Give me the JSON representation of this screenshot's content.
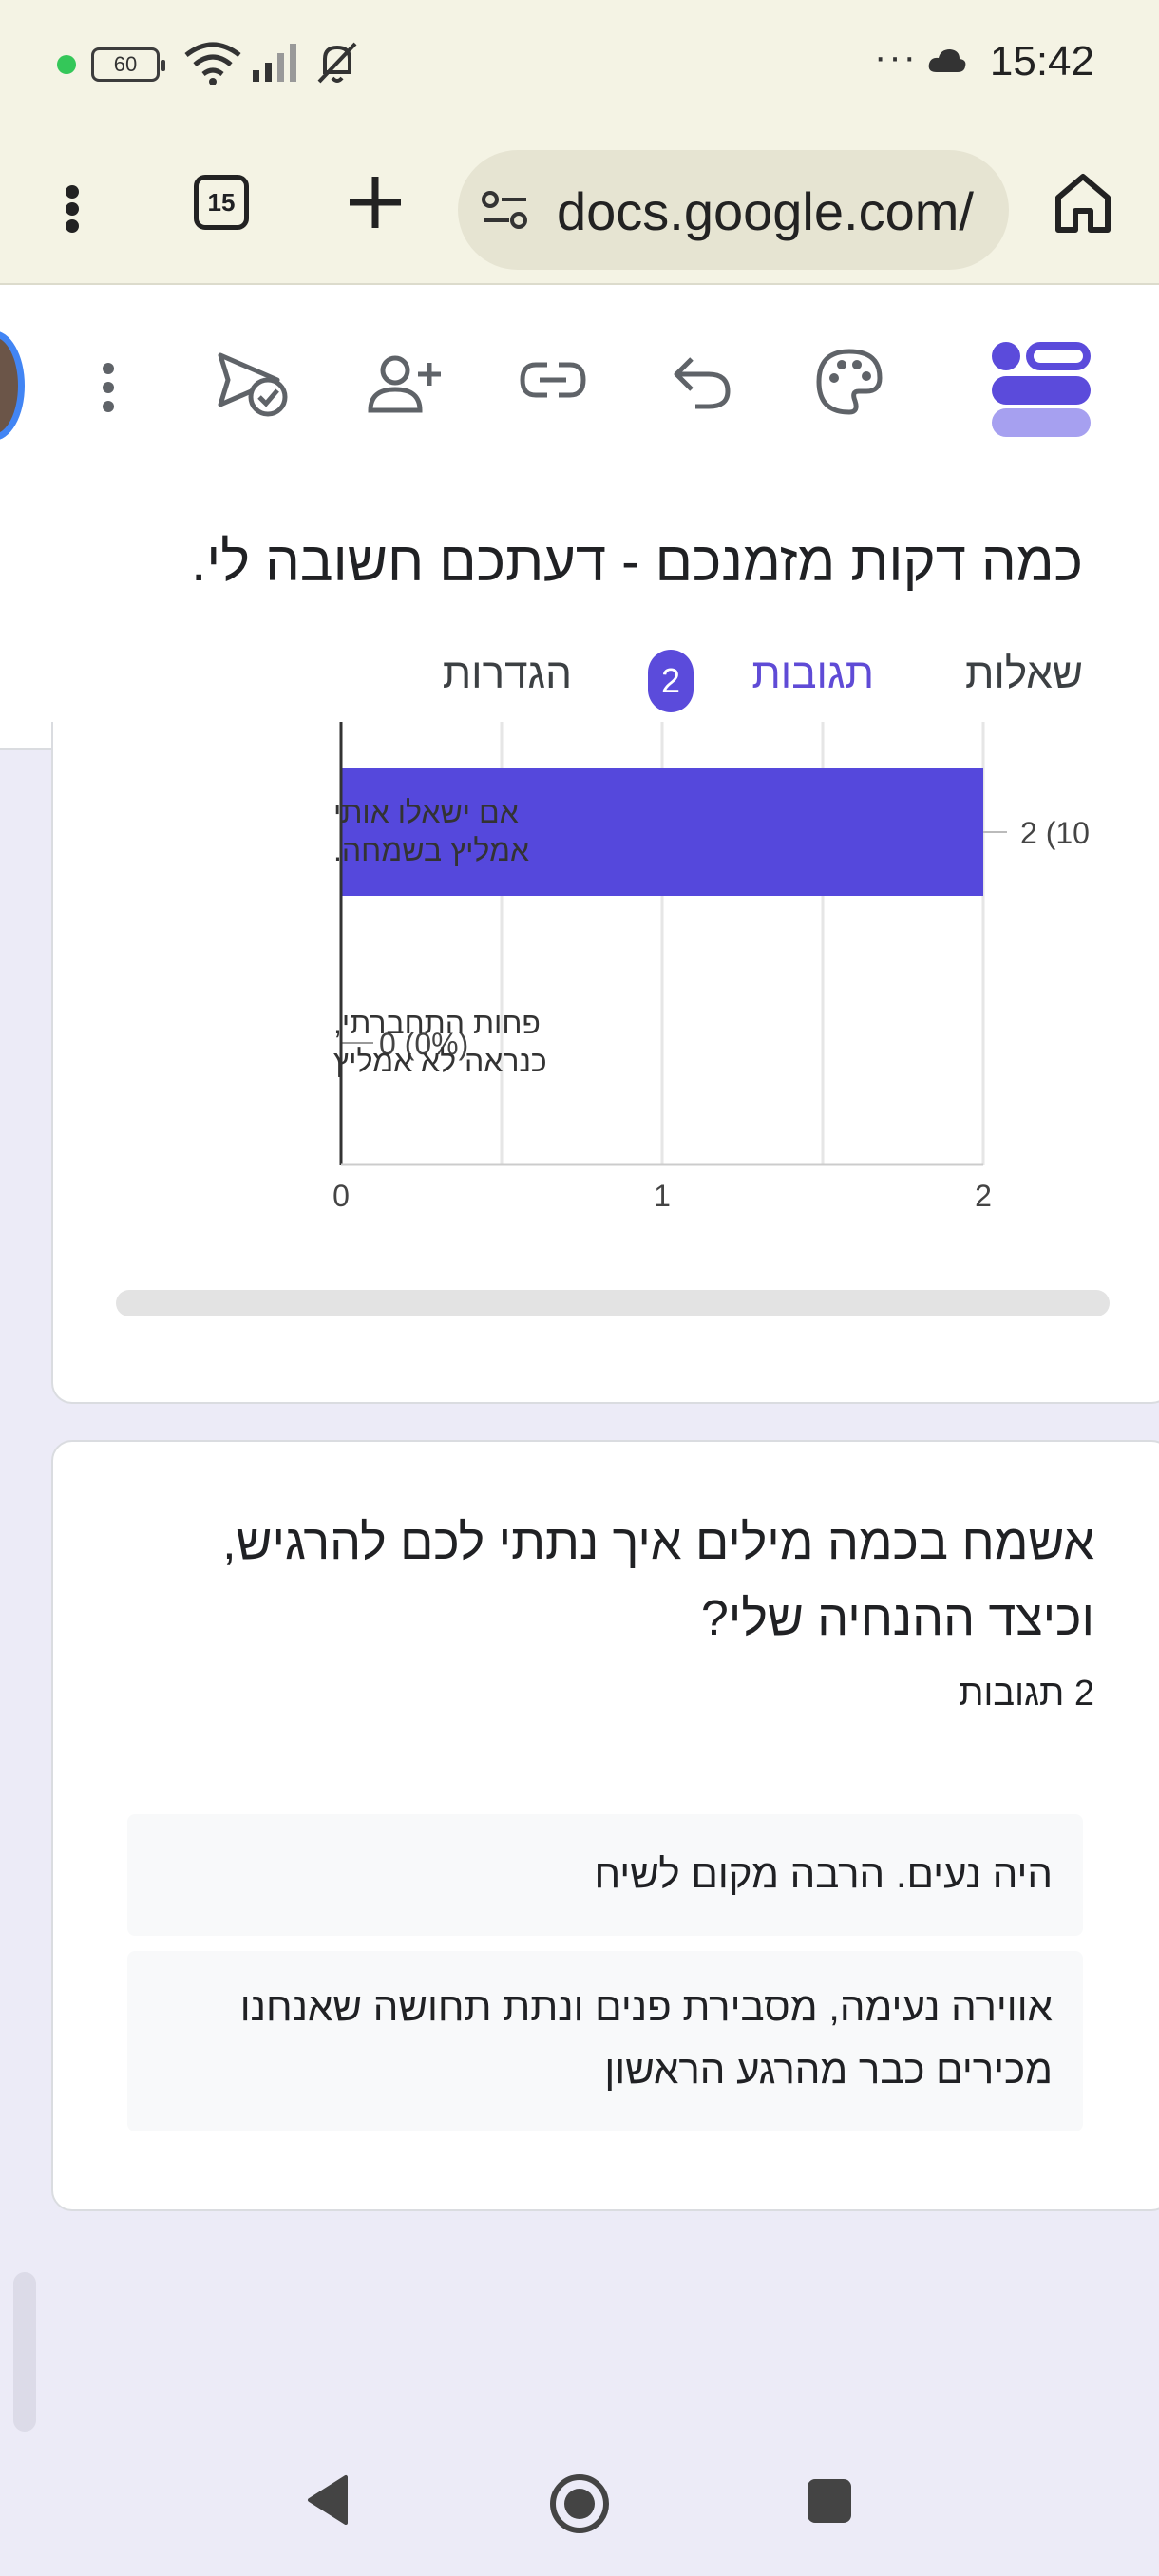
{
  "status_bar": {
    "time": "15:42",
    "battery": "60",
    "more": "···"
  },
  "browser": {
    "tab_count": "15",
    "url": "docs.google.com/"
  },
  "form": {
    "title": "כמה דקות מזמנכם - דעתכם חשובה לי.",
    "tabs": {
      "questions": "שאלות",
      "responses": "תגובות",
      "responses_count": "2",
      "settings": "הגדרות"
    }
  },
  "chart_data": {
    "type": "bar",
    "orientation": "horizontal",
    "categories": [
      "אם ישאלו אותי אמליץ בשמחה.",
      "פחות התחברתי, כנראה לא אמליץ"
    ],
    "category_lines": [
      [
        "אם ישאלו אותי",
        "אמליץ בשמחה."
      ],
      [
        "פחות התחברתי,",
        "כנראה לא אמליץ"
      ]
    ],
    "values": [
      2,
      0
    ],
    "data_labels": [
      "2 (10",
      "0 (0%)"
    ],
    "xticks": [
      "0",
      "1",
      "2"
    ],
    "xlim": [
      0,
      2
    ],
    "bar_color": "#5548dc",
    "grid": true
  },
  "question": {
    "title_line1": "אשמח בכמה מילים איך נתתי לכם להרגיש,",
    "title_line2": "וכיצד ההנחיה שלי?",
    "responses_label": "2 תגובות",
    "answers": [
      "היה נעים. הרבה מקום לשיח",
      "אווירה נעימה, מסבירת פנים ונתת תחושה שאנחנו מכירים כבר מהרגע הראשון"
    ]
  },
  "colors": {
    "accent": "#5b4bdb",
    "background": "#ecebf7",
    "browser_chrome": "#f4f3e4"
  }
}
